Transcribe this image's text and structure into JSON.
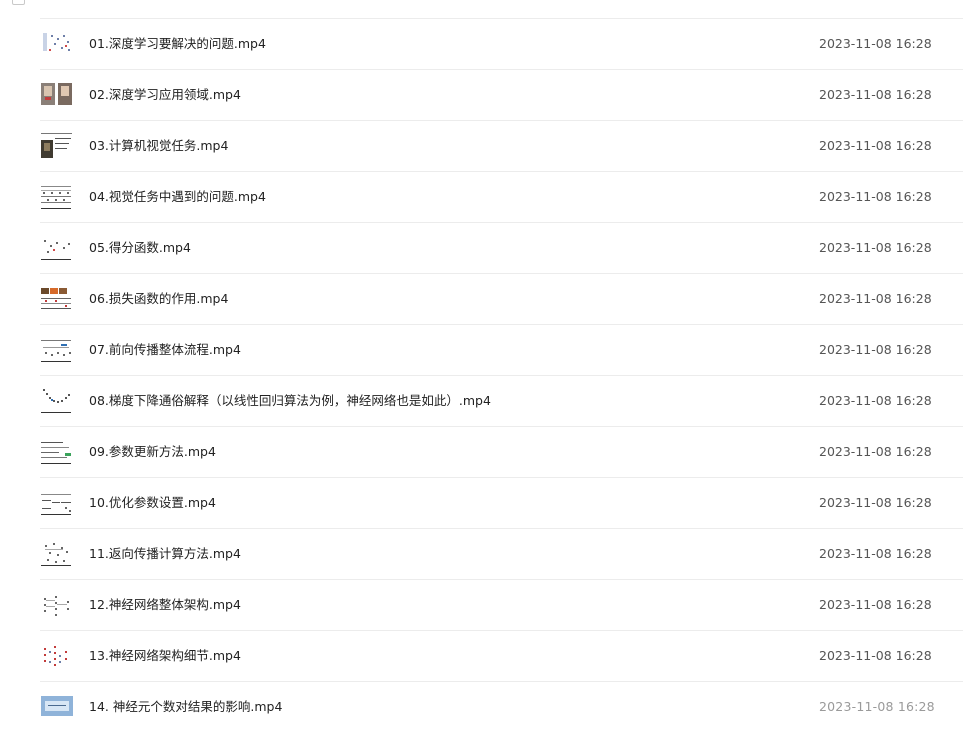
{
  "files": [
    {
      "name": "01.深度学习要解决的问题.mp4",
      "modified": "2023-11-08 16:28",
      "thumb": "slide-diagram"
    },
    {
      "name": "02.深度学习应用领域.mp4",
      "modified": "2023-11-08 16:28",
      "thumb": "faces"
    },
    {
      "name": "03.计算机视觉任务.mp4",
      "modified": "2023-11-08 16:28",
      "thumb": "photo-cat"
    },
    {
      "name": "04.视觉任务中遇到的问题.mp4",
      "modified": "2023-11-08 16:28",
      "thumb": "slide-grid"
    },
    {
      "name": "05.得分函数.mp4",
      "modified": "2023-11-08 16:28",
      "thumb": "slide-sparse"
    },
    {
      "name": "06.损失函数的作用.mp4",
      "modified": "2023-11-08 16:28",
      "thumb": "slide-table"
    },
    {
      "name": "07.前向传播整体流程.mp4",
      "modified": "2023-11-08 16:28",
      "thumb": "slide-flow"
    },
    {
      "name": "08.梯度下降通俗解释（以线性回归算法为例，神经网络也是如此）.mp4",
      "modified": "2023-11-08 16:28",
      "thumb": "slide-curve"
    },
    {
      "name": "09.参数更新方法.mp4",
      "modified": "2023-11-08 16:28",
      "thumb": "slide-formula"
    },
    {
      "name": "10.优化参数设置.mp4",
      "modified": "2023-11-08 16:28",
      "thumb": "slide-boxes"
    },
    {
      "name": "11.返向传播计算方法.mp4",
      "modified": "2023-11-08 16:28",
      "thumb": "slide-graph"
    },
    {
      "name": "12.神经网络整体架构.mp4",
      "modified": "2023-11-08 16:28",
      "thumb": "slide-network"
    },
    {
      "name": "13.神经网络架构细节.mp4",
      "modified": "2023-11-08 16:28",
      "thumb": "slide-network-red"
    },
    {
      "name": "14. 神经元个数对结果的影响.mp4",
      "modified": "2023-11-08 16:28",
      "thumb": "slide-blue"
    }
  ]
}
